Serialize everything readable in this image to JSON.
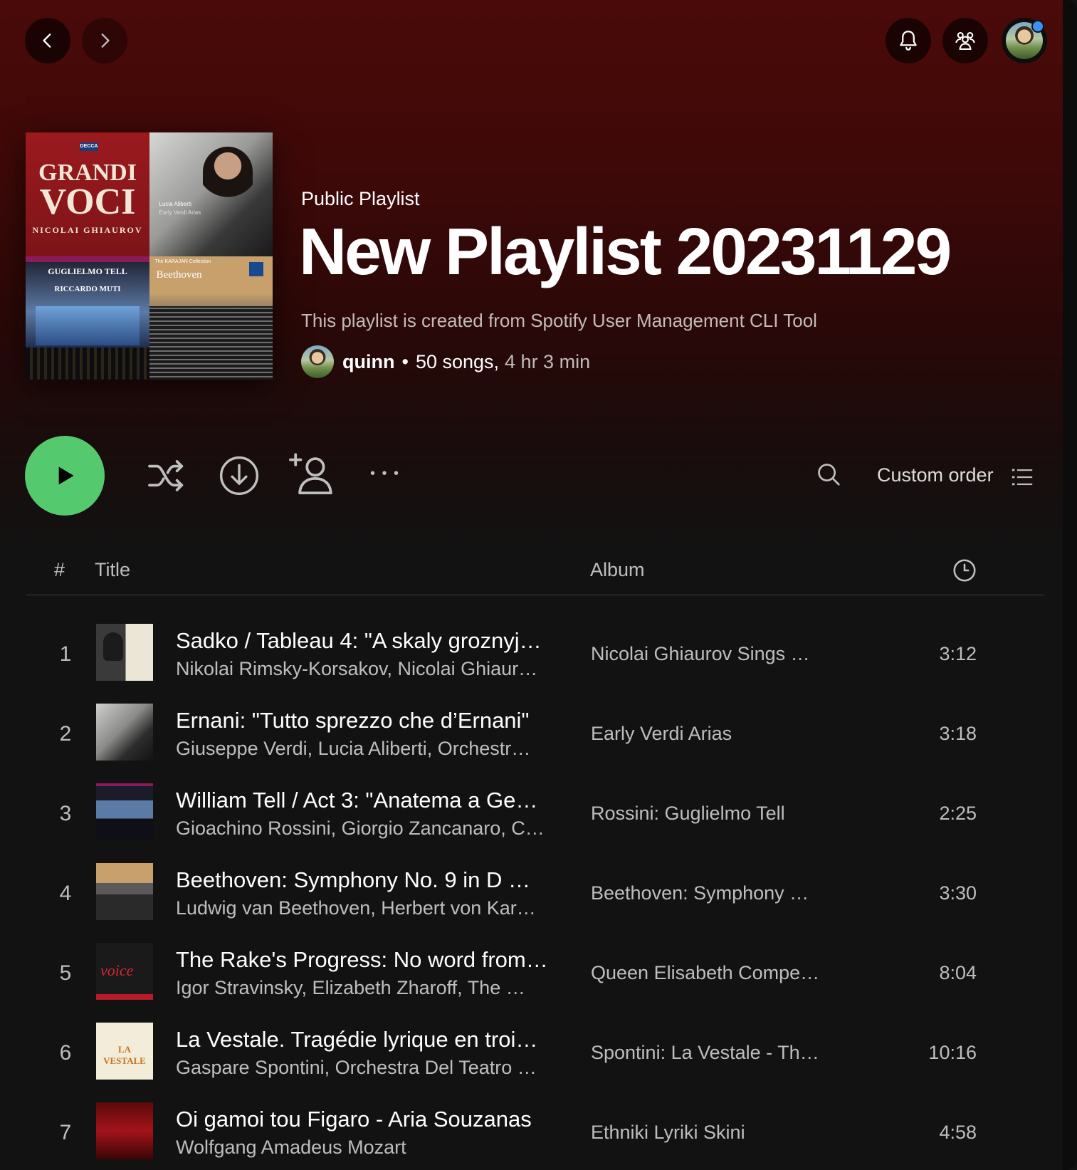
{
  "nav": {
    "back_icon": "chevron-left-icon",
    "forward_icon": "chevron-right-icon",
    "notifications_icon": "bell-icon",
    "friends_icon": "friends-icon"
  },
  "cover": {
    "tile1": {
      "label": "DECCA",
      "title1": "GRANDI",
      "title2": "VOCI",
      "artist": "NICOLAI GHIAUROV"
    },
    "tile2": {
      "line1": "Lucia Aliberti",
      "line2": "Early Verdi Arias"
    },
    "tile3": {
      "line1": "GUGLIELMO TELL",
      "line2": "RICCARDO MUTI"
    },
    "tile4": {
      "line1": "Beethoven",
      "line2": "The KARAJAN Collection"
    }
  },
  "header": {
    "kicker": "Public Playlist",
    "title": "New Playlist 20231129",
    "description": "This playlist is created from Spotify User Management CLI Tool",
    "owner": "quinn",
    "separator": "•",
    "song_count": "50 songs,",
    "duration": "4 hr 3 min"
  },
  "actions": {
    "sort_label": "Custom order",
    "more": "• • •"
  },
  "table_header": {
    "num": "#",
    "title": "Title",
    "album": "Album"
  },
  "tracks": [
    {
      "num": "1",
      "title": "Sadko / Tableau 4: \"A skaly groznyj…",
      "artist": "Nikolai Rimsky-Korsakov, Nicolai Ghiaur…",
      "album": "Nicolai Ghiaurov Sings …",
      "duration": "3:12"
    },
    {
      "num": "2",
      "title": "Ernani: \"Tutto sprezzo che d’Ernani\"",
      "artist": "Giuseppe Verdi, Lucia Aliberti, Orchestr…",
      "album": "Early Verdi Arias",
      "duration": "3:18"
    },
    {
      "num": "3",
      "title": "William Tell / Act 3: \"Anatema a Ge…",
      "artist": "Gioachino Rossini, Giorgio Zancanaro, C…",
      "album": "Rossini: Guglielmo Tell",
      "duration": "2:25"
    },
    {
      "num": "4",
      "title": "Beethoven: Symphony No. 9 in D …",
      "artist": "Ludwig van Beethoven, Herbert von Kar…",
      "album": "Beethoven: Symphony …",
      "duration": "3:30"
    },
    {
      "num": "5",
      "title": "The Rake's Progress: No word from…",
      "artist": "Igor Stravinsky, Elizabeth Zharoff, The …",
      "album": "Queen Elisabeth Compe…",
      "duration": "8:04"
    },
    {
      "num": "6",
      "title": "La Vestale. Tragédie lyrique en troi…",
      "artist": "Gaspare Spontini, Orchestra Del Teatro …",
      "album": "Spontini: La Vestale - Th…",
      "duration": "10:16"
    },
    {
      "num": "7",
      "title": "Oi gamoi tou Figaro - Aria Souzanas",
      "artist": "Wolfgang Amadeus Mozart",
      "album": "Ethniki Lyriki Skini",
      "duration": "4:58"
    }
  ],
  "thumb_text": {
    "t5": "voice",
    "t6": "LA VESTALE"
  },
  "colors": {
    "play": "#55c96d",
    "notification_dot": "#3d91f4",
    "hero": "#4a0a09"
  }
}
